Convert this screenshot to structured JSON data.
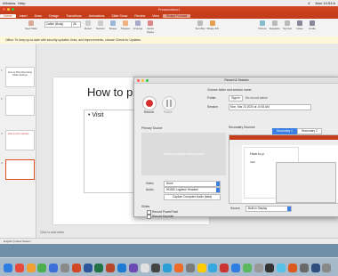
{
  "menubar": {
    "items": [
      "Window",
      "Help"
    ],
    "right": [
      "4",
      "Mon 10:53 A"
    ]
  },
  "window": {
    "title": "Presentation1"
  },
  "tabs": [
    "Home",
    "Insert",
    "Draw",
    "Design",
    "Transitions",
    "Animations",
    "Slide Show",
    "Review",
    "View",
    "Shape Format"
  ],
  "ribbon": {
    "font_name": "Calibri (Body)",
    "font_size": "28",
    "buttons": [
      "New Slide",
      "Reset",
      "Section",
      "Shape",
      "Shapes",
      "Arrange",
      "Quick Styles",
      "Text Box",
      "Shape Fill",
      "Picture",
      "Equation",
      "Symbol",
      "Video",
      "Audio"
    ]
  },
  "update_bar": {
    "text": "Office: To keep up-to-date with security updates, fixes, and improvements, choose Check for Updates."
  },
  "thumbnails": [
    {
      "num": "1",
      "text": "How to Print Recording Mode Settings"
    },
    {
      "num": "2",
      "text": ""
    },
    {
      "num": "3",
      "text": "How to print settings"
    },
    {
      "num": "4",
      "text": ""
    },
    {
      "num": "5",
      "text": ""
    }
  ],
  "slide": {
    "title": "How to pr",
    "bullet": "Visit"
  },
  "notes": {
    "placeholder": "Click to add notes"
  },
  "status": {
    "text": "English (United States)"
  },
  "recorder": {
    "title": "Record & Session",
    "record_label": "Record",
    "pause_label": "Pause",
    "choose_heading": "Choose folder and session name",
    "folder_label": "Folder",
    "folder_button": "Sign in",
    "folder_value": "No record active",
    "session_label": "Session",
    "session_value": "Mon, Mar 23 2020 at 10:53 AM",
    "primary_source": "Primary Source",
    "preview_text": "Select a primary video source",
    "video_label": "Video",
    "video_value": "None",
    "audio_label": "Audio",
    "audio_value": "HD630 Logitech Headset",
    "capture_button": "Capture Computer Audio (beta)",
    "slides_heading": "Slides",
    "record_pp": "Record PowerPoint",
    "record_keynote": "Record Keynote",
    "secondary_heading": "Secondary Sources",
    "secondary_tabs": [
      "Secondary 1",
      "Secondary 2"
    ],
    "source_label": "Source",
    "source_value": "Built-in Display",
    "mini_title": "How to p",
    "mini_bullet": "Visit"
  },
  "dock": {
    "colors": [
      "#2f7de0",
      "#e84a3c",
      "#f0a030",
      "#4caf50",
      "#3d6fd8",
      "#8a8a8a",
      "#d24726",
      "#2b579a",
      "#217346",
      "#b7472a",
      "#1f7ad3",
      "#6c4ab4",
      "#e0e0e0",
      "#444444",
      "#2a9fd6",
      "#ef6b28",
      "#7b7b7b",
      "#ffcc00",
      "#36a9e0",
      "#c33",
      "#2f7de0",
      "#5cb85c",
      "#999999",
      "#333333",
      "#56c1e8",
      "#dd5a1e",
      "#6a6a6a",
      "#2f4f7f",
      "#888888"
    ]
  }
}
